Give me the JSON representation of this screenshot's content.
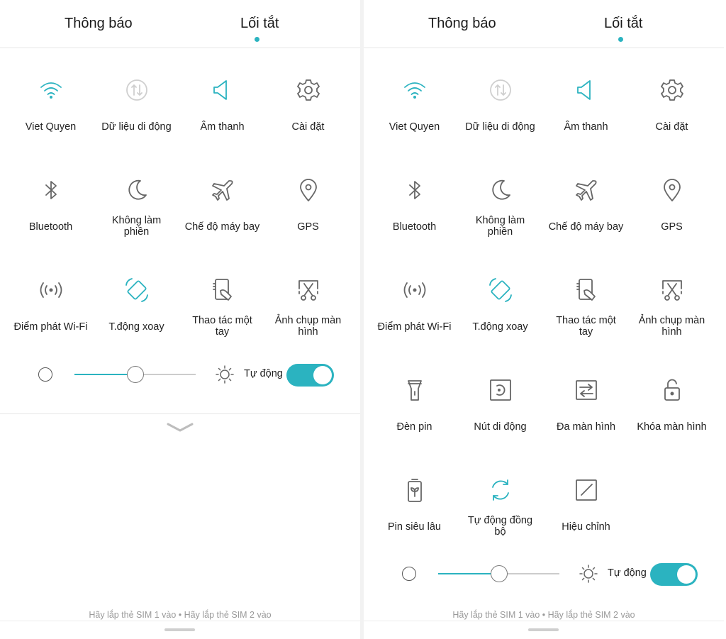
{
  "colors": {
    "accent": "#2bb3c0",
    "icon_gray": "#666666",
    "disabled_gray": "#cfcfcf"
  },
  "panels": [
    {
      "tabs": {
        "notifications": "Thông báo",
        "shortcuts": "Lối tắt"
      },
      "tiles": [
        {
          "label": "Viet Quyen",
          "icon": "wifi-icon",
          "active": true
        },
        {
          "label": "Dữ liệu di động",
          "icon": "mobile-data-icon",
          "active": false,
          "disabled": true
        },
        {
          "label": "Âm thanh",
          "icon": "speaker-icon",
          "active": true
        },
        {
          "label": "Cài đặt",
          "icon": "gear-icon",
          "active": false
        },
        {
          "label": "Bluetooth",
          "icon": "bluetooth-icon",
          "active": false
        },
        {
          "label": "Không làm phiền",
          "icon": "moon-icon",
          "active": false
        },
        {
          "label": "Chế độ máy bay",
          "icon": "airplane-icon",
          "active": false
        },
        {
          "label": "GPS",
          "icon": "location-pin-icon",
          "active": false
        },
        {
          "label": "Điểm phát Wi-Fi",
          "icon": "hotspot-icon",
          "active": false
        },
        {
          "label": "T.động xoay",
          "icon": "auto-rotate-icon",
          "active": true
        },
        {
          "label": "Thao tác một tay",
          "icon": "one-hand-icon",
          "active": false
        },
        {
          "label": "Ảnh chụp màn hình",
          "icon": "screenshot-icon",
          "active": false
        }
      ],
      "brightness": {
        "level_percent": 50,
        "auto_label": "Tự động",
        "auto_on": true
      },
      "sim_status": "Hãy lắp thẻ SIM 1 vào • Hãy lắp thẻ SIM 2 vào"
    },
    {
      "tabs": {
        "notifications": "Thông báo",
        "shortcuts": "Lối tắt"
      },
      "tiles": [
        {
          "label": "Viet Quyen",
          "icon": "wifi-icon",
          "active": true
        },
        {
          "label": "Dữ liệu di động",
          "icon": "mobile-data-icon",
          "active": false,
          "disabled": true
        },
        {
          "label": "Âm thanh",
          "icon": "speaker-icon",
          "active": true
        },
        {
          "label": "Cài đặt",
          "icon": "gear-icon",
          "active": false
        },
        {
          "label": "Bluetooth",
          "icon": "bluetooth-icon",
          "active": false
        },
        {
          "label": "Không làm phiền",
          "icon": "moon-icon",
          "active": false
        },
        {
          "label": "Chế độ máy bay",
          "icon": "airplane-icon",
          "active": false
        },
        {
          "label": "GPS",
          "icon": "location-pin-icon",
          "active": false
        },
        {
          "label": "Điểm phát Wi-Fi",
          "icon": "hotspot-icon",
          "active": false
        },
        {
          "label": "T.động xoay",
          "icon": "auto-rotate-icon",
          "active": true
        },
        {
          "label": "Thao tác một tay",
          "icon": "one-hand-icon",
          "active": false
        },
        {
          "label": "Ảnh chụp màn hình",
          "icon": "screenshot-icon",
          "active": false
        },
        {
          "label": "Đèn pin",
          "icon": "flashlight-icon",
          "active": false
        },
        {
          "label": "Nút di động",
          "icon": "floating-button-icon",
          "active": false
        },
        {
          "label": "Đa màn hình",
          "icon": "multi-screen-icon",
          "active": false
        },
        {
          "label": "Khóa màn hình",
          "icon": "lock-icon",
          "active": false
        },
        {
          "label": "Pin siêu lâu",
          "icon": "battery-saver-icon",
          "active": false
        },
        {
          "label": "Tự động đồng bộ",
          "icon": "sync-icon",
          "active": true
        },
        {
          "label": "Hiệu chỉnh",
          "icon": "edit-icon",
          "active": false
        }
      ],
      "brightness": {
        "level_percent": 50,
        "auto_label": "Tự động",
        "auto_on": true
      },
      "sim_status": "Hãy lắp thẻ SIM 1 vào • Hãy lắp thẻ SIM 2 vào"
    }
  ]
}
